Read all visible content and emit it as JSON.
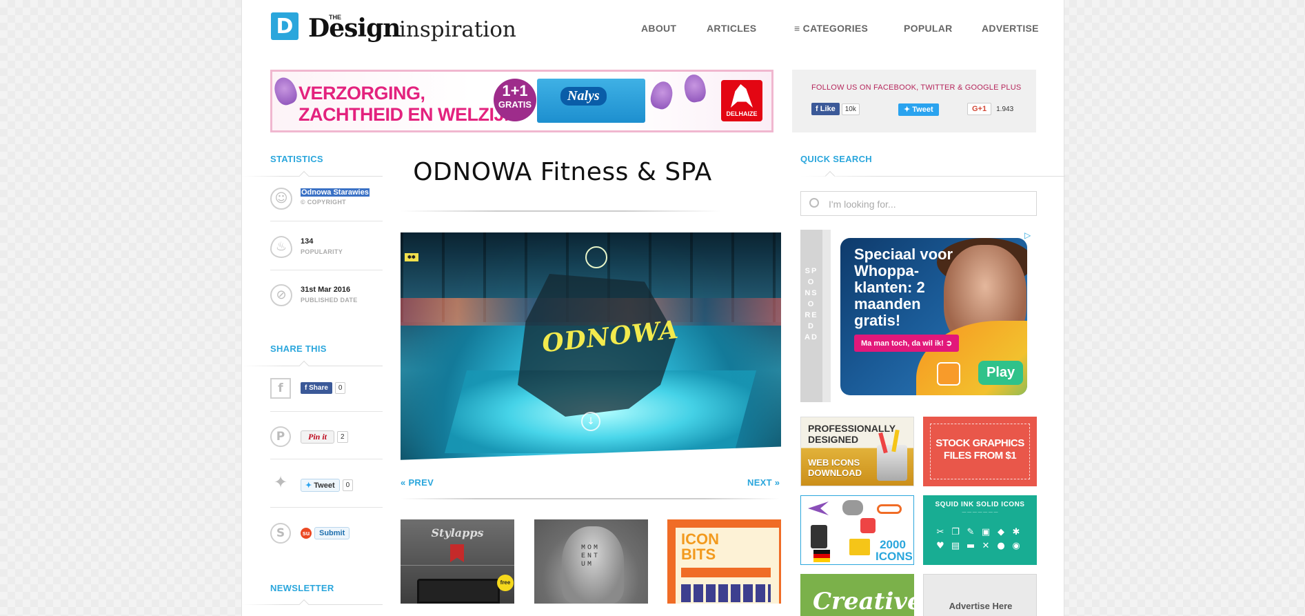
{
  "header": {
    "logo_letter": "D",
    "logo_the": "THE",
    "logo_design": "Design",
    "logo_inspiration": "inspiration",
    "nav": [
      "ABOUT",
      "ARTICLES",
      "≡ CATEGORIES",
      "POPULAR",
      "ADVERTISE"
    ]
  },
  "banner_ad": {
    "line1": "VERZORGING,",
    "line2": "ZACHTHEID EN WELZIJN",
    "promo": "1+1",
    "promo_sub": "GRATIS",
    "product": "Nalys",
    "store": "DELHAIZE"
  },
  "follow": {
    "title": "FOLLOW US ON FACEBOOK, TWITTER & GOOGLE PLUS",
    "like_label": "Like",
    "like_count": "10k",
    "tweet_label": "Tweet",
    "gplus_label": "G+1",
    "gplus_count": "1.943"
  },
  "statistics": {
    "title": "STATISTICS",
    "items": [
      {
        "value": "Odnowa Starawies",
        "label": "© COPYRIGHT",
        "icon": "smiley-icon"
      },
      {
        "value": "134",
        "label": "POPULARITY",
        "icon": "flame-icon"
      },
      {
        "value": "31st Mar 2016",
        "label": "PUBLISHED DATE",
        "icon": "compass-icon"
      }
    ]
  },
  "share": {
    "title": "SHARE THIS",
    "facebook": {
      "label": "Share",
      "count": "0"
    },
    "pinterest": {
      "label": "Pin it",
      "count": "2"
    },
    "twitter": {
      "label": "Tweet",
      "count": "0"
    },
    "stumble": {
      "label": "Submit"
    }
  },
  "newsletter": {
    "title": "NEWSLETTER"
  },
  "main": {
    "title": "ODNOWA Fitness & SPA",
    "hero_brand": "ODNOWA",
    "prev_label": "« PREV",
    "next_label": "NEXT »",
    "thumbs": [
      {
        "title": "Stylapps",
        "badge": "free"
      },
      {
        "title": "MOMENTUM"
      },
      {
        "title": "ICON BITS"
      }
    ]
  },
  "sidebar": {
    "quick_search_title": "QUICK SEARCH",
    "search_placeholder": "I'm looking for...",
    "sponsored_label": "SPONSORED AD",
    "big_ad": {
      "title": "Speciaal voor Whoppa-klanten: 2 maanden gratis!",
      "pill": "Ma man toch, da wil ik!",
      "play": "Play"
    },
    "ads": [
      {
        "line1": "PROFESSIONALLY",
        "line2": "DESIGNED",
        "line3": "WEB ICONS",
        "line4": "DOWNLOAD"
      },
      {
        "line1": "STOCK GRAPHICS",
        "line2": "FILES FROM $1"
      },
      {
        "line1": "2000",
        "line2": "ICONS"
      },
      {
        "line1": "SQUID INK SOLID ICONS"
      },
      {
        "line1": "Creative"
      },
      {
        "line1": "Advertise Here"
      }
    ]
  },
  "colors": {
    "accent": "#2aa6dc",
    "promo": "#e3227e",
    "follow_title": "#b5265b"
  }
}
